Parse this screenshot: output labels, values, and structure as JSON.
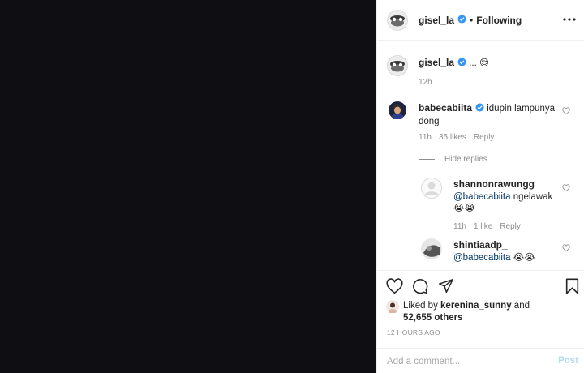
{
  "header": {
    "username": "gisel_la",
    "separator": "•",
    "follow_status": "Following",
    "more_icon": "more-horizontal-icon"
  },
  "caption": {
    "username": "gisel_la",
    "text": "... 😌",
    "time": "12h"
  },
  "comments": [
    {
      "username": "babecabiita",
      "text": "idupin lampunya dong",
      "time": "11h",
      "likes": "35 likes",
      "reply": "Reply"
    }
  ],
  "hide_replies": "Hide replies",
  "replies": [
    {
      "username": "shannonrawungg",
      "mention": "@babecabiita",
      "text": " ngelawak",
      "emoji": "😭😭",
      "time": "11h",
      "likes": "1 like",
      "reply": "Reply"
    },
    {
      "username": "shintiaadp_",
      "mention": "@babecabiita",
      "emoji": " 😭😭"
    }
  ],
  "likes": {
    "prefix": "Liked by ",
    "user": "kerenina_sunny",
    "middle": " and",
    "count": "52,655 others"
  },
  "post_time": "12 HOURS AGO",
  "add_comment": {
    "placeholder": "Add a comment...",
    "post_label": "Post"
  },
  "colors": {
    "media_bg": "#0f0e13",
    "verified": "#3897f0",
    "mention": "#00376b",
    "post_disabled": "#b3dbff"
  }
}
